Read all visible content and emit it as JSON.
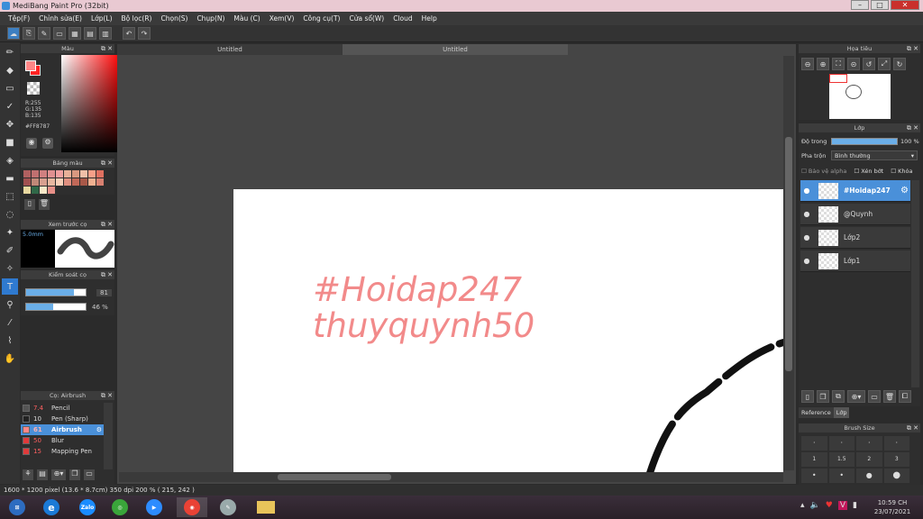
{
  "window": {
    "title": "MediBang Paint Pro (32bit)"
  },
  "menu": [
    "Tệp(F)",
    "Chỉnh sửa(E)",
    "Lớp(L)",
    "Bộ lọc(R)",
    "Chọn(S)",
    "Chụp(N)",
    "Màu (C)",
    "Xem(V)",
    "Công cụ(T)",
    "Cửa sổ(W)",
    "Cloud",
    "Help"
  ],
  "colors": {
    "header": "Màu",
    "r": "R:255",
    "g": "G:135",
    "b": "B:135",
    "hex": "#FF8787",
    "fg": "#ff8787",
    "accent": "#4a90d9"
  },
  "palette": {
    "header": "Bảng màu"
  },
  "brush_preview": {
    "header": "Xem trước cọ",
    "size": "5.0mm"
  },
  "control": {
    "header": "Kiểm soát cọ",
    "size_value": "81",
    "opacity_value": "46 %",
    "size_level": 0.81,
    "opacity_level": 0.46
  },
  "brushes": {
    "header": "Cọ: Airbrush",
    "items": [
      {
        "size": "7.4",
        "name": "Pencil",
        "swatch": "#555555"
      },
      {
        "size": "10",
        "name": "Pen (Sharp)",
        "swatch": "#222222"
      },
      {
        "size": "61",
        "name": "Airbrush",
        "swatch": "#ff8787",
        "selected": true
      },
      {
        "size": "50",
        "name": "Blur",
        "swatch": "#e03a3a"
      },
      {
        "size": "15",
        "name": "Mapping Pen",
        "swatch": "#e03a3a"
      }
    ]
  },
  "tabs": [
    "Untitled",
    "Untitled"
  ],
  "canvas": {
    "line1": "#Hoidap247",
    "line2": "thuyquynh50"
  },
  "status": "1600 * 1200 pixel   (13.6 * 8.7cm)   350 dpi   200 %   ( 215, 242 )",
  "navigator": {
    "header": "Họa tiêu"
  },
  "layers": {
    "header": "Lớp",
    "opacity_label": "Độ trong",
    "opacity_value": "100 %",
    "blend_label": "Pha trộn",
    "blend_value": "Bình thường",
    "protect_alpha": "Bảo vệ alpha",
    "clipping": "Xén bớt",
    "lock": "Khóa",
    "items": [
      {
        "name": "#Hoidap247",
        "selected": true
      },
      {
        "name": "@Quynh"
      },
      {
        "name": "Lớp2"
      },
      {
        "name": "Lớp1"
      }
    ],
    "tab_reference": "Reference",
    "tab_layers": "Lớp"
  },
  "brush_size": {
    "header": "Brush Size",
    "labels": [
      "1",
      "1.5",
      "2",
      "3"
    ]
  },
  "taskbar": {
    "zalo": "Zalo",
    "time": "10:59 CH",
    "date": "23/07/2021"
  }
}
